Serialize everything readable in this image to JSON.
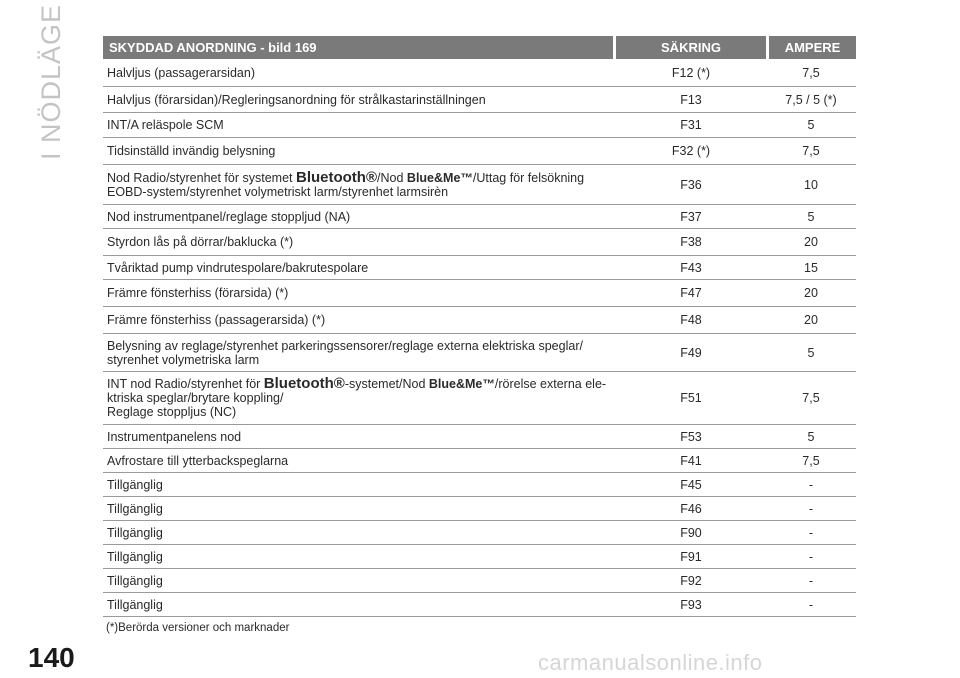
{
  "side_title": "I NÖDLÄGE",
  "page_number": "140",
  "table": {
    "headers": {
      "device": "SKYDDAD ANORDNING - bild 169",
      "fuse": "SÄKRING",
      "ampere": "AMPERE"
    },
    "rows": [
      {
        "desc": "Halvljus (passagerarsidan)",
        "fuse": "F12 (*)",
        "amp": "7,5"
      },
      {
        "desc": "Halvljus (förarsidan)/Regleringsanordning för strålkastarinställningen",
        "fuse": "F13",
        "amp": "7,5 / 5 (*)"
      },
      {
        "desc": "INT/A reläspole SCM",
        "fuse": "F31",
        "amp": "5"
      },
      {
        "desc": "Tidsinställd invändig belysning",
        "fuse": "F32 (*)",
        "amp": "7,5"
      },
      {
        "desc_parts": [
          "Nod Radio/styrenhet för systemet ",
          "Bluetooth®",
          "/Nod ",
          "Blue&Me™",
          "/Uttag för felsökning",
          "EOBD-system/styrenhet volymetriskt larm/styrenhet larmsirèn"
        ],
        "fuse": "F36",
        "amp": "10"
      },
      {
        "desc": "Nod instrumentpanel/reglage stoppljud (NA)",
        "fuse": "F37",
        "amp": "5"
      },
      {
        "desc": "Styrdon lås på dörrar/baklucka (*)",
        "fuse": "F38",
        "amp": "20"
      },
      {
        "desc": "Tvåriktad pump vindrutespolare/bakrutespolare",
        "fuse": "F43",
        "amp": "15"
      },
      {
        "desc": "Främre fönsterhiss (förarsida) (*)",
        "fuse": "F47",
        "amp": "20"
      },
      {
        "desc": "Främre fönsterhiss (passagerarsida) (*)",
        "fuse": "F48",
        "amp": "20"
      },
      {
        "desc_lines": [
          "Belysning av reglage/styrenhet parkeringssensorer/reglage externa elektriska speglar/",
          "styrenhet volymetriska larm"
        ],
        "fuse": "F49",
        "amp": "5"
      },
      {
        "desc_parts": [
          "INT nod Radio/styrenhet för ",
          "Bluetooth®",
          "-systemet/Nod ",
          "Blue&Me™",
          "/rörelse externa ele-",
          "ktriska speglar/brytare koppling/",
          "Reglage stoppljus (NC)"
        ],
        "fuse": "F51",
        "amp": "7,5"
      },
      {
        "desc": "Instrumentpanelens nod",
        "fuse": "F53",
        "amp": "5"
      },
      {
        "desc": "Avfrostare till ytterbackspeglarna",
        "fuse": "F41",
        "amp": "7,5"
      },
      {
        "desc": "Tillgänglig",
        "fuse": "F45",
        "amp": "-"
      },
      {
        "desc": "Tillgänglig",
        "fuse": "F46",
        "amp": "-"
      },
      {
        "desc": "Tillgänglig",
        "fuse": "F90",
        "amp": "-"
      },
      {
        "desc": "Tillgänglig",
        "fuse": "F91",
        "amp": "-"
      },
      {
        "desc": "Tillgänglig",
        "fuse": "F92",
        "amp": "-"
      },
      {
        "desc": "Tillgänglig",
        "fuse": "F93",
        "amp": "-"
      }
    ]
  },
  "footnote": "(*)Berörda versioner och marknader",
  "watermark": "carmanualsonline.info"
}
